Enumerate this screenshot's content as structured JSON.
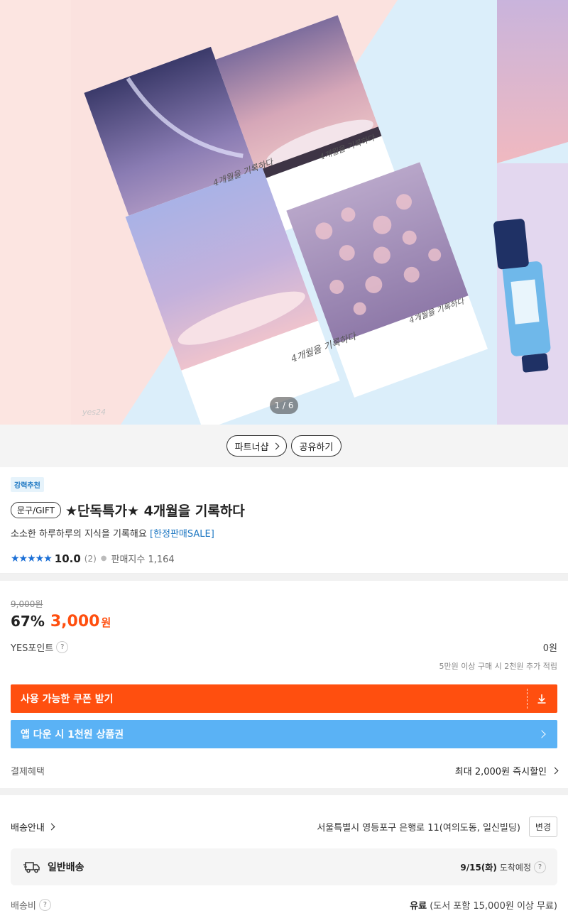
{
  "carousel": {
    "counter": "1 / 6",
    "watermark": "yes24",
    "notebook_cover_text": "4개월을 기록하다"
  },
  "actions": {
    "partner_label": "파트너샵",
    "share_label": "공유하기"
  },
  "product": {
    "badge": "강력추천",
    "category": "문구/GIFT",
    "title": "★단독특가★ 4개월을 기록하다",
    "subtitle": "소소한 하루하루의 지식을 기록해요",
    "subtitle_highlight": "[한정판매SALE]",
    "stars": "★★★★★",
    "rating": "10.0",
    "review_count": "(2)",
    "sales_label": "판매지수 1,164"
  },
  "price": {
    "original": "9,000원",
    "discount": "67%",
    "sale_price": "3,000",
    "currency": "원",
    "point_label": "YES포인트",
    "point_value": "0원",
    "point_note": "5만원 이상 구매 시 2천원 추가 적립",
    "coupon_button": "사용 가능한 쿠폰 받기",
    "app_button": "앱 다운 시 1천원 상품권",
    "pay_label": "결제혜택",
    "pay_value": "최대 2,000원 즉시할인"
  },
  "delivery": {
    "guide_label": "배송안내",
    "address": "서울특별시 영등포구 은행로 11(여의도동, 일신빌딩)",
    "change_button": "변경",
    "type_label": "일반배송",
    "eta_date": "9/15(화)",
    "eta_suffix": "도착예정",
    "fee_label": "배송비",
    "fee_strong": "유료",
    "fee_note": "(도서 포함 15,000원 이상 무료)"
  },
  "colors": {
    "accent_orange": "#ff4f0f",
    "accent_blue": "#5ab2f5",
    "link_blue": "#1b76c2"
  }
}
